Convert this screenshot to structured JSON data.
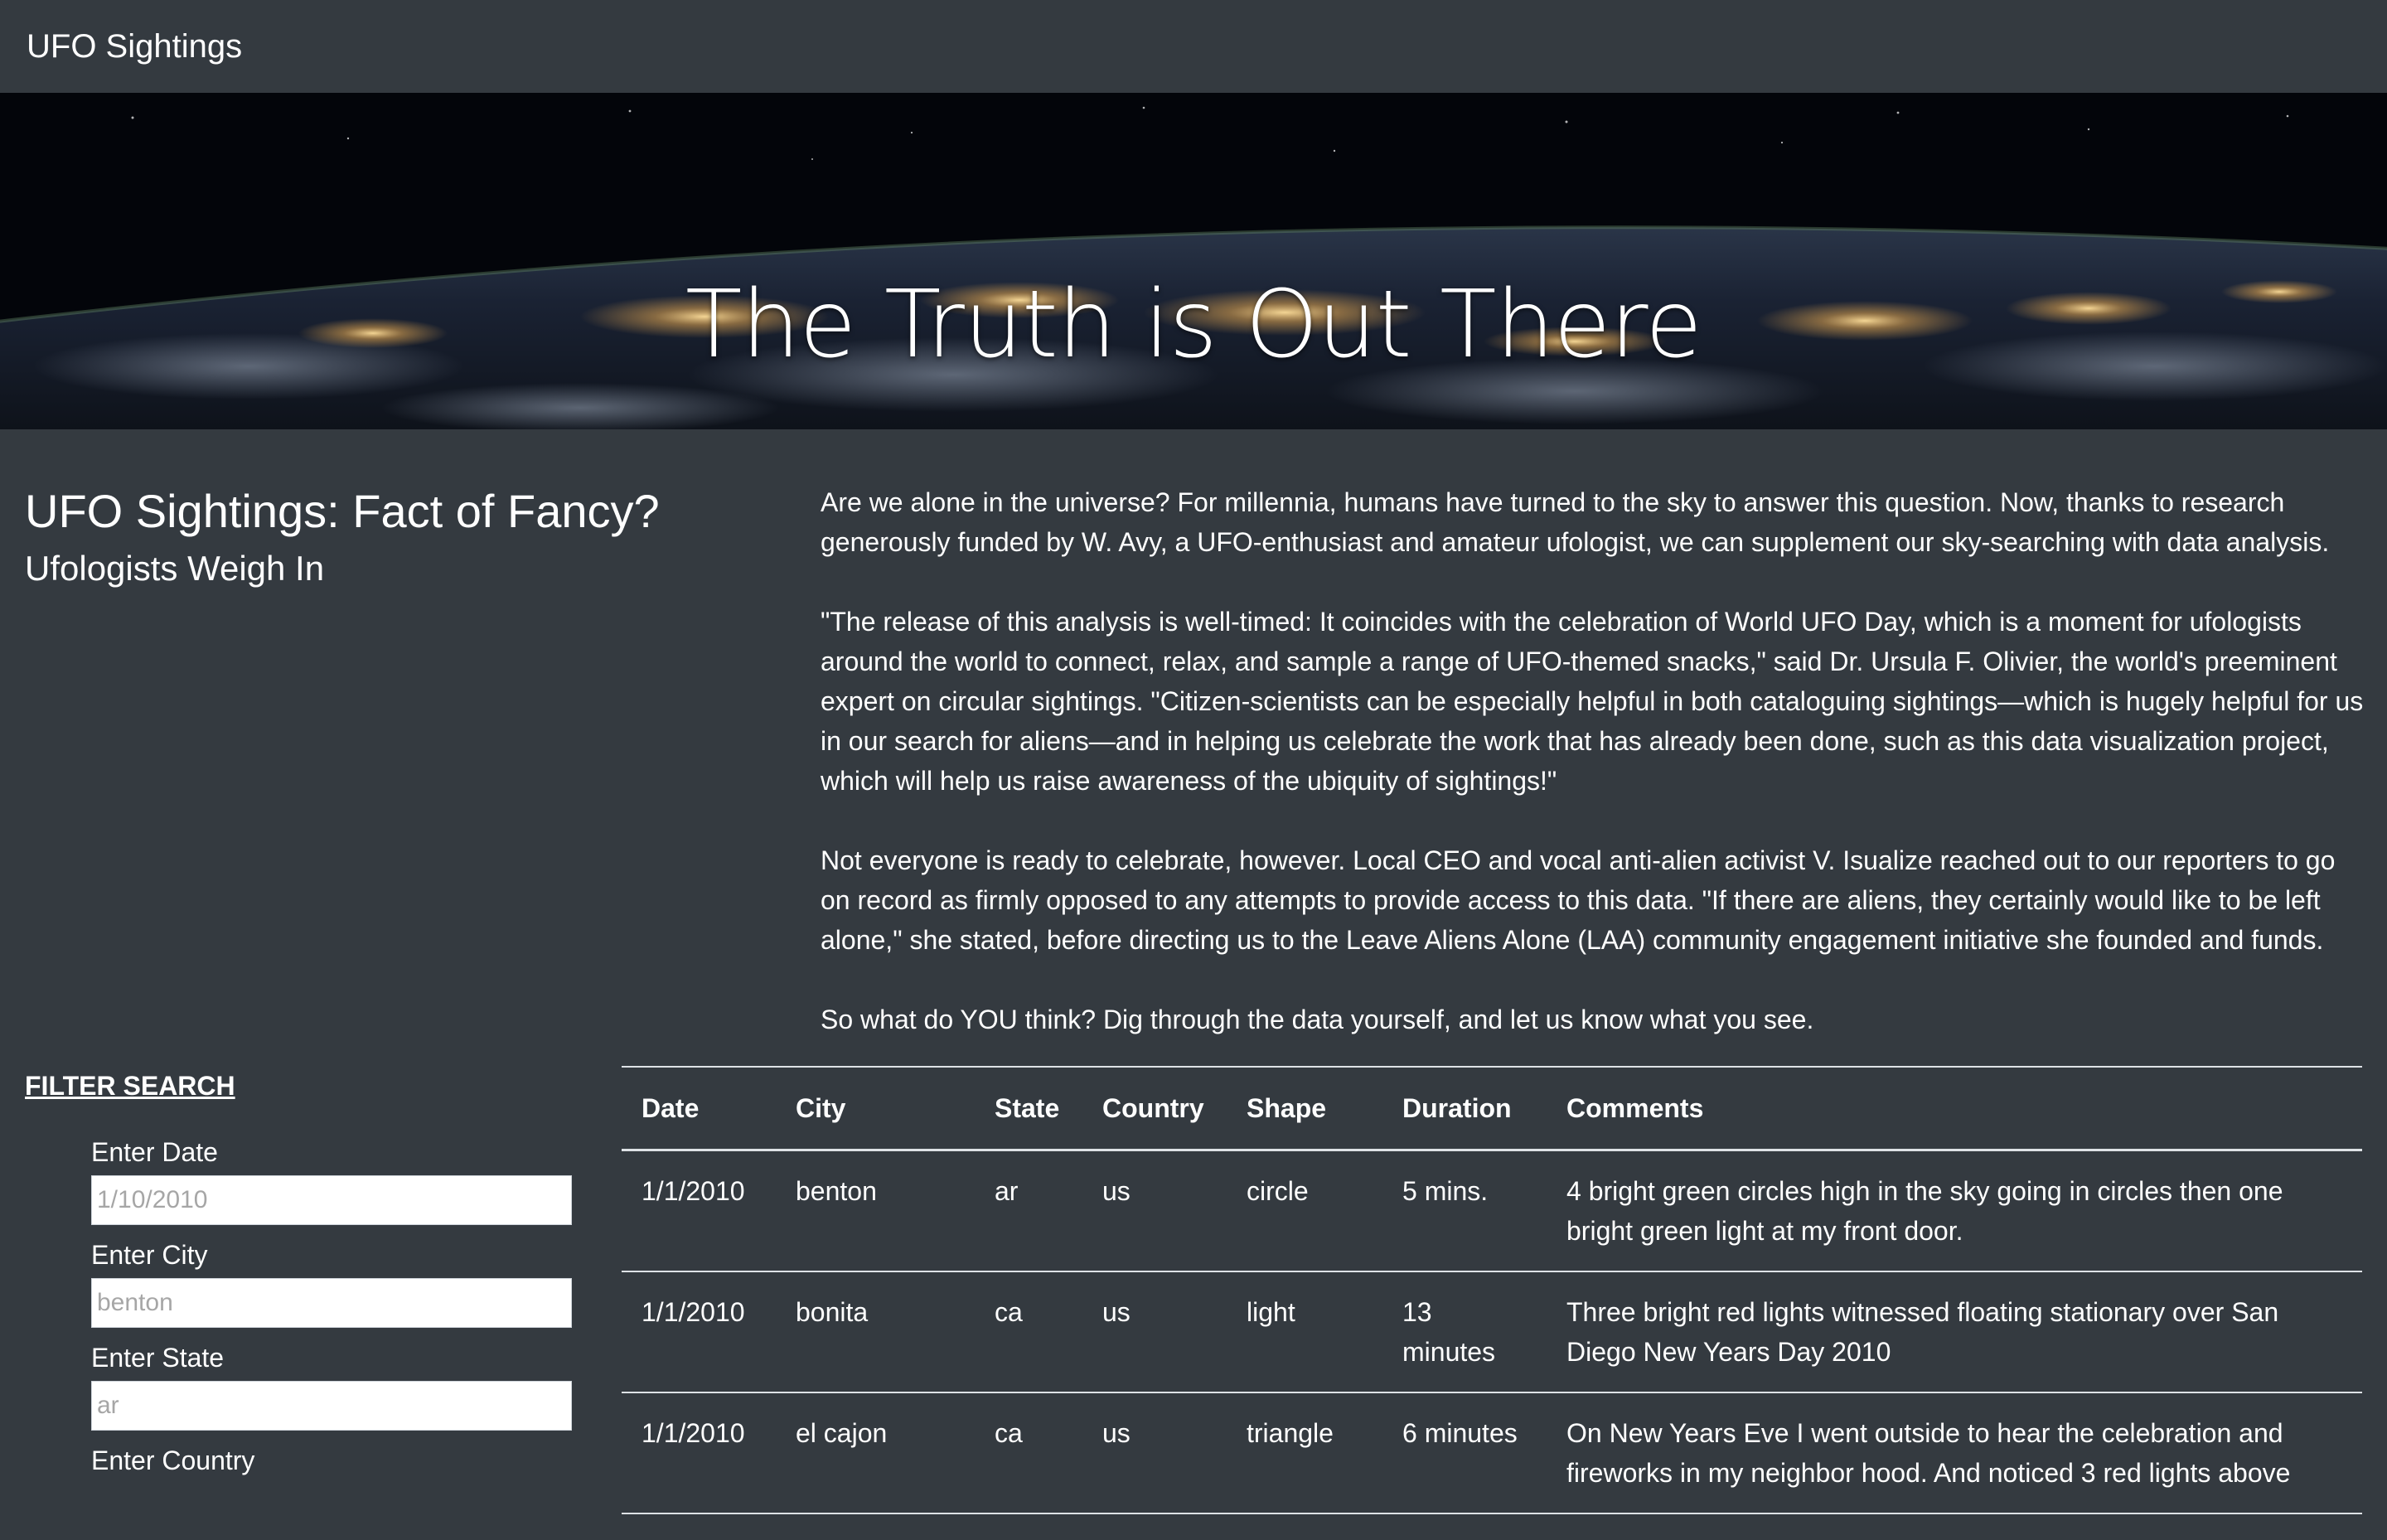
{
  "navbar": {
    "brand": "UFO Sightings"
  },
  "hero": {
    "title": "The Truth is Out There"
  },
  "article": {
    "title": "UFO Sightings: Fact of Fancy?",
    "subtitle": "Ufologists Weigh In",
    "paragraphs": [
      "Are we alone in the universe? For millennia, humans have turned to the sky to answer this question. Now, thanks to research generously funded by W. Avy, a UFO-enthusiast and amateur ufologist, we can supplement our sky-searching with data analysis.",
      "\"The release of this analysis is well-timed: It coincides with the celebration of World UFO Day, which is a moment for ufologists around the world to connect, relax, and sample a range of UFO-themed snacks,\" said Dr. Ursula F. Olivier, the world's preeminent expert on circular sightings. \"Citizen-scientists can be especially helpful in both cataloguing sightings—which is hugely helpful for us in our search for aliens—and in helping us celebrate the work that has already been done, such as this data visualization project, which will help us raise awareness of the ubiquity of sightings!\"",
      "Not everyone is ready to celebrate, however. Local CEO and vocal anti-alien activist V. Isualize reached out to our reporters to go on record as firmly opposed to any attempts to provide access to this data. \"If there are aliens, they certainly would like to be left alone,\" she stated, before directing us to the Leave Aliens Alone (LAA) community engagement initiative she founded and funds.",
      "So what do YOU think? Dig through the data yourself, and let us know what you see."
    ]
  },
  "filter": {
    "heading": "FILTER SEARCH",
    "fields": [
      {
        "label": "Enter Date",
        "placeholder": "1/10/2010"
      },
      {
        "label": "Enter City",
        "placeholder": "benton"
      },
      {
        "label": "Enter State",
        "placeholder": "ar"
      },
      {
        "label": "Enter Country",
        "placeholder": ""
      }
    ]
  },
  "table": {
    "headers": [
      "Date",
      "City",
      "State",
      "Country",
      "Shape",
      "Duration",
      "Comments"
    ],
    "rows": [
      [
        "1/1/2010",
        "benton",
        "ar",
        "us",
        "circle",
        "5 mins.",
        "4 bright green circles high in the sky going in circles then one bright green light at my front door."
      ],
      [
        "1/1/2010",
        "bonita",
        "ca",
        "us",
        "light",
        "13 minutes",
        "Three bright red lights witnessed floating stationary over San Diego New Years Day 2010"
      ],
      [
        "1/1/2010",
        "el cajon",
        "ca",
        "us",
        "triangle",
        "6 minutes",
        "On New Years Eve I went outside to hear the celebration and fireworks in my neighbor hood. And noticed 3 red lights above"
      ]
    ]
  },
  "colors": {
    "background": "#343a40",
    "text": "#ffffff",
    "rule": "#dee2e6"
  }
}
